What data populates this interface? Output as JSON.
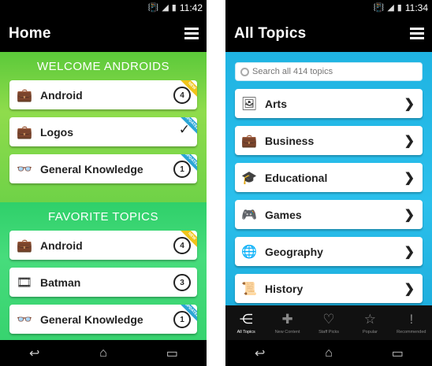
{
  "left": {
    "status": {
      "time": "11:42"
    },
    "title": "Home",
    "sections": [
      {
        "header": "WELCOME ANDROIDS",
        "items": [
          {
            "label": "Android",
            "icon": "briefcase-icon",
            "glyph": "💼",
            "badge": "4",
            "ribbon": "NEW",
            "ribbon_type": "new",
            "check": false
          },
          {
            "label": "Logos",
            "icon": "briefcase-icon",
            "glyph": "💼",
            "badge": "",
            "ribbon": "UPDATED",
            "ribbon_type": "updated",
            "check": true
          },
          {
            "label": "General Knowledge",
            "icon": "glasses-icon",
            "glyph": "👓",
            "badge": "1",
            "ribbon": "UPDATED",
            "ribbon_type": "updated",
            "check": false
          }
        ]
      },
      {
        "header": "FAVORITE TOPICS",
        "items": [
          {
            "label": "Android",
            "icon": "briefcase-icon",
            "glyph": "💼",
            "badge": "4",
            "ribbon": "NEW",
            "ribbon_type": "new",
            "check": false
          },
          {
            "label": "Batman",
            "icon": "film-icon",
            "glyph": "🎞",
            "badge": "3",
            "ribbon": "",
            "ribbon_type": "",
            "check": false
          },
          {
            "label": "General Knowledge",
            "icon": "glasses-icon",
            "glyph": "👓",
            "badge": "1",
            "ribbon": "UPDATED",
            "ribbon_type": "updated",
            "check": false
          }
        ]
      }
    ]
  },
  "right": {
    "status": {
      "time": "11:34"
    },
    "title": "All Topics",
    "search": {
      "placeholder": "Search all 414 topics"
    },
    "topics": [
      {
        "label": "Arts",
        "icon": "arts-icon",
        "glyph": "🖼"
      },
      {
        "label": "Business",
        "icon": "briefcase-icon",
        "glyph": "💼"
      },
      {
        "label": "Educational",
        "icon": "graduation-cap-icon",
        "glyph": "🎓"
      },
      {
        "label": "Games",
        "icon": "gamepad-icon",
        "glyph": "🎮"
      },
      {
        "label": "Geography",
        "icon": "globe-icon",
        "glyph": "🌐"
      },
      {
        "label": "History",
        "icon": "history-icon",
        "glyph": "📜"
      }
    ],
    "tabs": [
      {
        "label": "All Topics",
        "icon": "all-topics-icon",
        "glyph": "⋲",
        "active": true
      },
      {
        "label": "New Content",
        "icon": "plus-icon",
        "glyph": "✚",
        "active": false
      },
      {
        "label": "Staff Picks",
        "icon": "heart-icon",
        "glyph": "♡",
        "active": false
      },
      {
        "label": "Popular",
        "icon": "star-icon",
        "glyph": "☆",
        "active": false
      },
      {
        "label": "Recommended",
        "icon": "exclamation-icon",
        "glyph": "!",
        "active": false
      }
    ]
  },
  "colors": {
    "green": "#6fd247",
    "mint": "#37d36f",
    "blue": "#1fb3e2",
    "new_ribbon": "#f0c419",
    "updated_ribbon": "#2aa6d6"
  }
}
